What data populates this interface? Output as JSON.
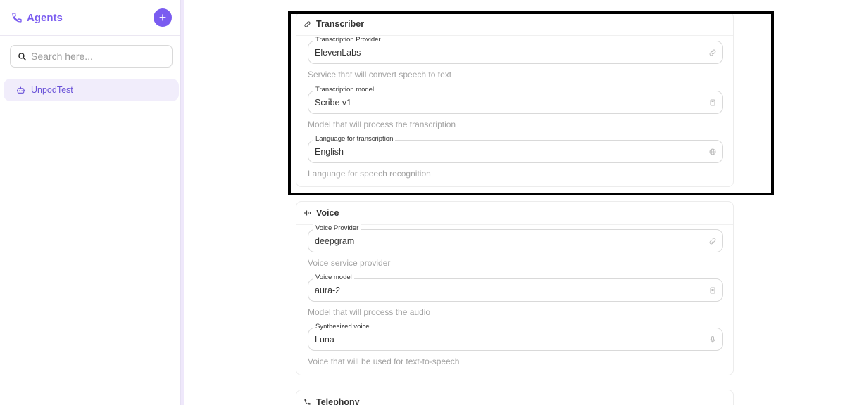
{
  "sidebar": {
    "title": "Agents",
    "add_label": "+",
    "search_placeholder": "Search here...",
    "agents": [
      {
        "label": "UnpodTest"
      }
    ]
  },
  "transcriber": {
    "title": "Transcriber",
    "fields": [
      {
        "label": "Transcription Provider",
        "value": "ElevenLabs",
        "help": "Service that will convert speech to text",
        "icon": "link-icon"
      },
      {
        "label": "Transcription model",
        "value": "Scribe v1",
        "help": "Model that will process the transcription",
        "icon": "chip-icon"
      },
      {
        "label": "Language for transcription",
        "value": "English",
        "help": "Language for speech recognition",
        "icon": "globe-icon"
      }
    ]
  },
  "voice": {
    "title": "Voice",
    "fields": [
      {
        "label": "Voice Provider",
        "value": "deepgram",
        "help": "Voice service provider",
        "icon": "link-icon"
      },
      {
        "label": "Voice model",
        "value": "aura-2",
        "help": "Model that will process the audio",
        "icon": "chip-icon"
      },
      {
        "label": "Synthesized voice",
        "value": "Luna",
        "help": "Voice that will be used for text-to-speech",
        "icon": "mic-icon"
      }
    ]
  },
  "telephony": {
    "title": "Telephony"
  },
  "colors": {
    "accent": "#7a5cf0",
    "accent_light": "#f1edfb"
  }
}
